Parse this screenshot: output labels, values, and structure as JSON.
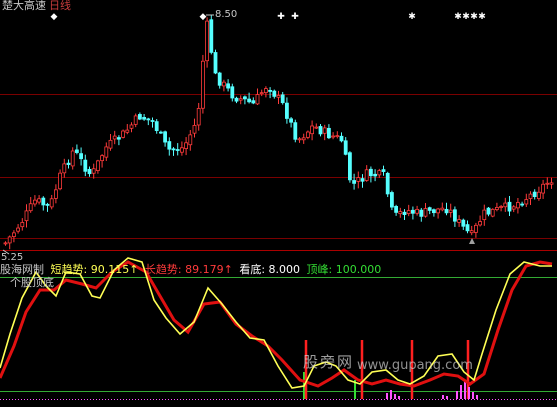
{
  "header": {
    "stock_name": "楚大高速",
    "period": "日线"
  },
  "price_panel": {
    "high_label": "8.50",
    "low_label": "5.25",
    "marker_symbols": [
      "◆",
      "✚",
      "✚",
      "✱",
      "✱",
      "✱",
      "✱",
      "✱"
    ]
  },
  "indicator_panel": {
    "name": "股海网制",
    "short_trend": "短趋势: 90.115↑",
    "long_trend": "长趋势: 89.179↑",
    "bottom_watch": "看底: 8.000",
    "peak": "顶峰: 100.000",
    "sub_title": "个股顶底"
  },
  "watermark": {
    "cn": "股旁网",
    "url": "www.gupang.com"
  },
  "colors": {
    "up_candle": "#ff3b3b",
    "down_candle": "#55ffff",
    "short_trend_line": "#ffff55",
    "long_trend_line": "#e01010",
    "bottom_signal": "#33dd33",
    "top_signal": "#ff2020",
    "histogram": "#ff55ff",
    "grid": "#7a0000"
  }
}
